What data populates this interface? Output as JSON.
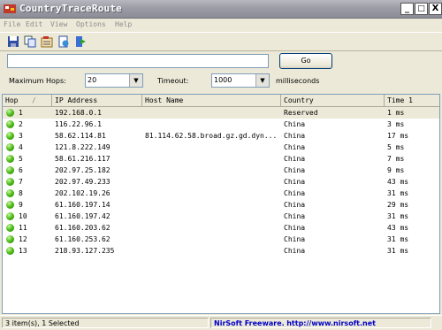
{
  "window": {
    "title": "CountryTraceRoute"
  },
  "window_buttons": {
    "minimize": "_",
    "maximize": "□",
    "close": "X"
  },
  "menu": [
    "File",
    "Edit",
    "View",
    "Options",
    "Help"
  ],
  "toolbar": {
    "icons": [
      "save-icon",
      "copy-icon",
      "properties-icon",
      "html-report-icon",
      "exit-icon"
    ]
  },
  "address": {
    "value": "",
    "go_label": "Go"
  },
  "options": {
    "max_hops_label": "Maximum Hops:",
    "max_hops_value": "20",
    "timeout_label": "Timeout:",
    "timeout_value": "1000",
    "timeout_unit": "milliseconds"
  },
  "table": {
    "columns": [
      "Hop",
      "IP Address",
      "Host Name",
      "Country",
      "Time 1"
    ],
    "sort_marker": "/",
    "rows": [
      {
        "hop": "1",
        "ip": "192.168.0.1",
        "host": "",
        "country": "Reserved",
        "time": "1 ms"
      },
      {
        "hop": "2",
        "ip": "116.22.96.1",
        "host": "",
        "country": "China",
        "time": "3 ms"
      },
      {
        "hop": "3",
        "ip": "58.62.114.81",
        "host": "81.114.62.58.broad.gz.gd.dyn...",
        "country": "China",
        "time": "17 ms"
      },
      {
        "hop": "4",
        "ip": "121.8.222.149",
        "host": "",
        "country": "China",
        "time": "5 ms"
      },
      {
        "hop": "5",
        "ip": "58.61.216.117",
        "host": "",
        "country": "China",
        "time": "7 ms"
      },
      {
        "hop": "6",
        "ip": "202.97.25.182",
        "host": "",
        "country": "China",
        "time": "9 ms"
      },
      {
        "hop": "7",
        "ip": "202.97.49.233",
        "host": "",
        "country": "China",
        "time": "43 ms"
      },
      {
        "hop": "8",
        "ip": "202.102.19.26",
        "host": "",
        "country": "China",
        "time": "31 ms"
      },
      {
        "hop": "9",
        "ip": "61.160.197.14",
        "host": "",
        "country": "China",
        "time": "29 ms"
      },
      {
        "hop": "10",
        "ip": "61.160.197.42",
        "host": "",
        "country": "China",
        "time": "31 ms"
      },
      {
        "hop": "11",
        "ip": "61.160.203.62",
        "host": "",
        "country": "China",
        "time": "43 ms"
      },
      {
        "hop": "12",
        "ip": "61.160.253.62",
        "host": "",
        "country": "China",
        "time": "31 ms"
      },
      {
        "hop": "13",
        "ip": "218.93.127.235",
        "host": "",
        "country": "China",
        "time": "31 ms"
      }
    ]
  },
  "status": {
    "items": "3 item(s), 1 Selected",
    "brand": "NirSoft Freeware.",
    "url": "http://www.nirsoft.net"
  }
}
